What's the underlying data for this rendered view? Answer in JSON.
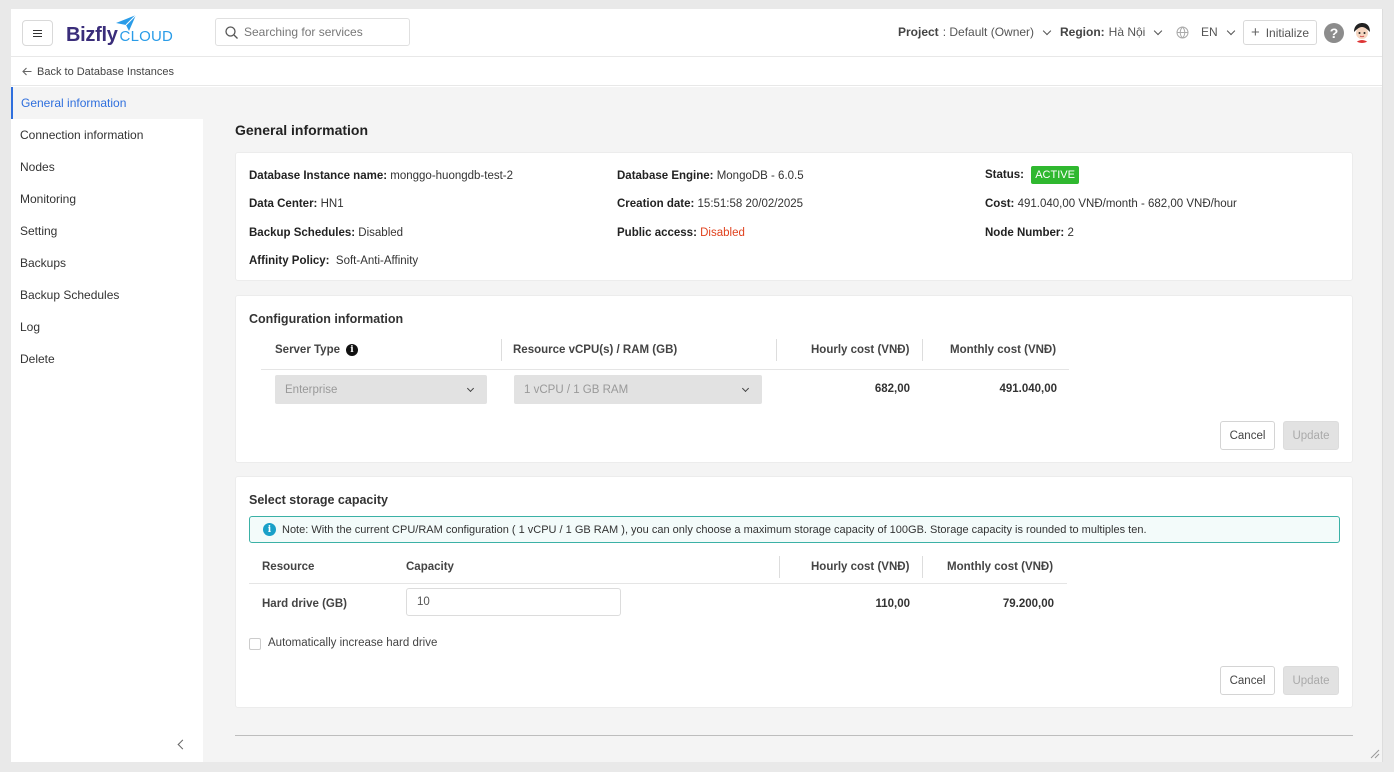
{
  "header": {
    "logo_primary": "Bizfly",
    "logo_secondary": "CLOUD",
    "search_placeholder": "Searching for services",
    "project_label": "Project",
    "project_value": ": Default (Owner)",
    "region_label": "Region:",
    "region_value": "Hà Nội",
    "language": "EN",
    "initialize_label": "Initialize",
    "help_symbol": "?"
  },
  "breadcrumb": {
    "back_label": "Back to Database Instances"
  },
  "sidebar": {
    "items": [
      {
        "label": "General information",
        "active": true
      },
      {
        "label": "Connection information"
      },
      {
        "label": "Nodes"
      },
      {
        "label": "Monitoring"
      },
      {
        "label": "Setting"
      },
      {
        "label": "Backups"
      },
      {
        "label": "Backup Schedules"
      },
      {
        "label": "Log"
      },
      {
        "label": "Delete"
      }
    ]
  },
  "page": {
    "title": "General information"
  },
  "general": {
    "instance_name_label": "Database Instance name:",
    "instance_name_value": "monggo-huongdb-test-2",
    "engine_label": "Database Engine:",
    "engine_value": "MongoDB - 6.0.5",
    "status_label": "Status:",
    "status_value": "ACTIVE",
    "datacenter_label": "Data Center:",
    "datacenter_value": "HN1",
    "creation_label": "Creation date:",
    "creation_value": "15:51:58 20/02/2025",
    "cost_label": "Cost:",
    "cost_value": "491.040,00 VNĐ/month - 682,00 VNĐ/hour",
    "backup_label": "Backup Schedules:",
    "backup_value": "Disabled",
    "public_label": "Public access:",
    "public_value": "Disabled",
    "node_label": "Node Number:",
    "node_value": "2",
    "affinity_label": "Affinity Policy:",
    "affinity_value": "Soft-Anti-Affinity"
  },
  "config": {
    "title": "Configuration information",
    "col_server_type": "Server Type",
    "col_resource": "Resource vCPU(s) / RAM (GB)",
    "col_hourly": "Hourly cost (VNĐ)",
    "col_monthly": "Monthly cost (VNĐ)",
    "server_type_value": "Enterprise",
    "resource_value": "1 vCPU / 1 GB RAM",
    "hourly_value": "682,00",
    "monthly_value": "491.040,00",
    "cancel_label": "Cancel",
    "update_label": "Update"
  },
  "storage": {
    "title": "Select storage capacity",
    "note": "Note: With the current CPU/RAM configuration ( 1 vCPU / 1 GB RAM ), you can only choose a maximum storage capacity of 100GB. Storage capacity is rounded to multiples ten.",
    "col_resource": "Resource",
    "col_capacity": "Capacity",
    "col_hourly": "Hourly cost (VNĐ)",
    "col_monthly": "Monthly cost (VNĐ)",
    "row_label": "Hard drive (GB)",
    "capacity_value": "10",
    "hourly_value": "110,00",
    "monthly_value": "79.200,00",
    "auto_increase_label": "Automatically increase hard drive",
    "auto_increase_checked": false,
    "cancel_label": "Cancel",
    "update_label": "Update"
  },
  "colors": {
    "accent": "#2f6fdd",
    "status_active": "#2fb82f",
    "danger": "#e0421e",
    "note_border": "#3bb1a6"
  }
}
